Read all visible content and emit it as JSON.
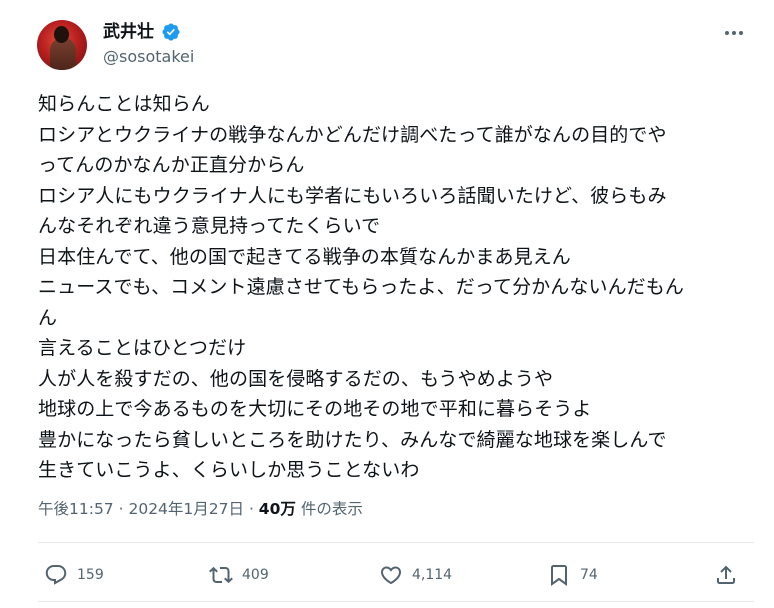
{
  "author": {
    "name": "武井壮",
    "handle": "@sosotakei",
    "verified": true
  },
  "tweet": {
    "lines": [
      "知らんことは知らん",
      "ロシアとウクライナの戦争なんかどんだけ調べたって誰がなんの目的でや",
      "ってんのかなんか正直分からん",
      "ロシア人にもウクライナ人にも学者にもいろいろ話聞いたけど、彼らもみ",
      "んなそれぞれ違う意見持ってたくらいで",
      "日本住んでて、他の国で起きてる戦争の本質なんかまあ見えん",
      "ニュースでも、コメント遠慮させてもらったよ、だって分かんないんだもん",
      "ん",
      "言えることはひとつだけ",
      "人が人を殺すだの、他の国を侵略するだの、もうやめようや",
      "地球の上で今あるものを大切にその地その地で平和に暮らそうよ",
      "豊かになったら貧しいところを助けたり、みんなで綺麗な地球を楽しんで",
      "生きていこうよ、くらいしか思うことないわ"
    ]
  },
  "meta": {
    "time": "午後11:57",
    "separator": "·",
    "date": "2024年1月27日",
    "views_count": "40万",
    "views_label": "件の表示"
  },
  "actions": {
    "replies": "159",
    "retweets": "409",
    "likes": "4,114",
    "bookmarks": "74"
  },
  "colors": {
    "text": "#0f1419",
    "secondary": "#536471",
    "verified": "#1d9bf0",
    "divider": "#e7eaed"
  }
}
